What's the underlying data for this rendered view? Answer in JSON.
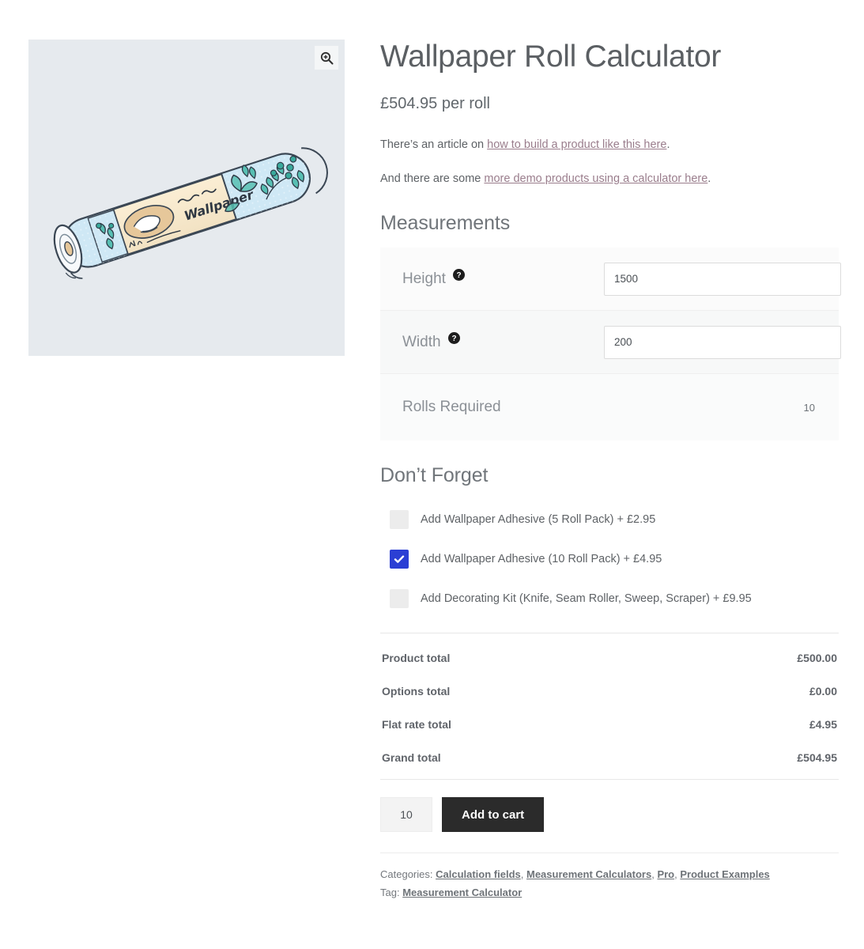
{
  "gallery": {
    "zoom_icon": "magnify-plus-icon",
    "image_alt": "wallpaper-roll-illustration",
    "background_color": "#e6eaee"
  },
  "product": {
    "title": "Wallpaper Roll Calculator",
    "price": "£504.95 per roll",
    "description_1_before": "There’s an article on ",
    "description_1_link": "how to build a product like this here",
    "description_1_after": ".",
    "description_2_before": "And there are some ",
    "description_2_link": "more demo products using a calculator here",
    "description_2_after": "."
  },
  "measurements": {
    "heading": "Measurements",
    "rows": [
      {
        "label": "Height",
        "value": "1500",
        "help": "help-icon",
        "type": "input"
      },
      {
        "label": "Width",
        "value": "200",
        "help": "help-icon",
        "type": "input"
      },
      {
        "label": "Rolls Required",
        "value": "10",
        "type": "result"
      }
    ]
  },
  "options": {
    "heading": "Don’t Forget",
    "items": [
      {
        "label": "Add Wallpaper Adhesive (5 Roll Pack) + £2.95",
        "checked": false
      },
      {
        "label": "Add Wallpaper Adhesive (10 Roll Pack) + £4.95",
        "checked": true
      },
      {
        "label": "Add Decorating Kit (Knife, Seam Roller, Sweep, Scraper) + £9.95",
        "checked": false
      }
    ],
    "checked_color": "#2b3fd4"
  },
  "totals": [
    {
      "label": "Product total",
      "amount": "£500.00"
    },
    {
      "label": "Options total",
      "amount": "£0.00"
    },
    {
      "label": "Flat rate total",
      "amount": "£4.95"
    },
    {
      "label": "Grand total",
      "amount": "£504.95"
    }
  ],
  "cart": {
    "quantity": "10",
    "add_to_cart_label": "Add to cart"
  },
  "meta": {
    "categories_label": "Categories:",
    "categories": [
      "Calculation fields",
      "Measurement Calculators",
      "Pro",
      "Product Examples"
    ],
    "tag_label": "Tag:",
    "tags": [
      "Measurement Calculator"
    ]
  }
}
